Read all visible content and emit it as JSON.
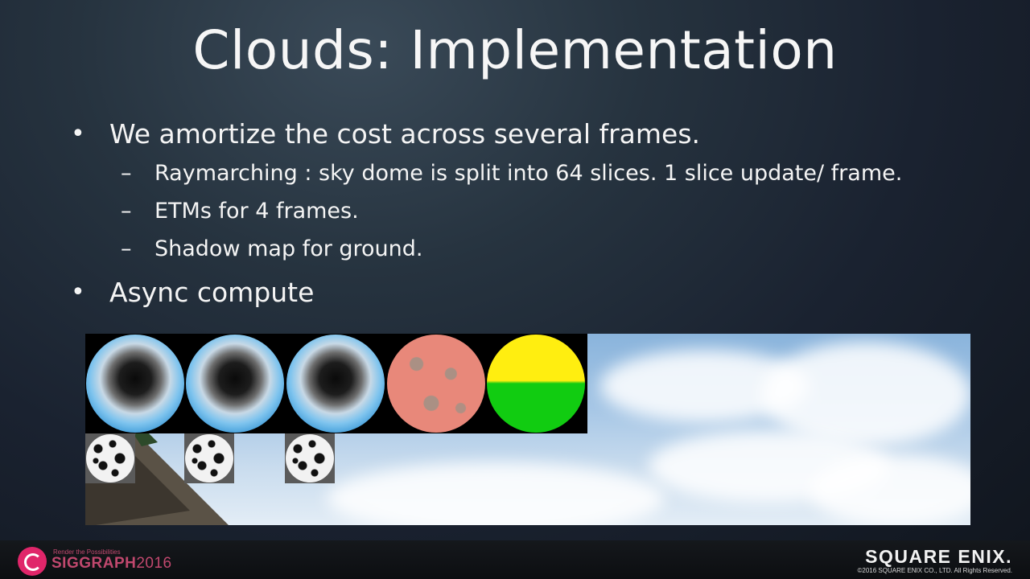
{
  "slide": {
    "title": "Clouds: Implementation",
    "bullets": [
      {
        "text": "We amortize the cost across several frames.",
        "subs": [
          "Raymarching : sky dome is split into 64 slices. 1 slice update/ frame.",
          "ETMs for 4 frames.",
          "Shadow map for ground."
        ]
      },
      {
        "text": "Async compute"
      }
    ],
    "bullet_glyph": "•",
    "dash_glyph": "–"
  },
  "footer": {
    "siggraph_tagline": "Render the Possibilities",
    "siggraph_name": "SIGGRAPH",
    "siggraph_year": "2016",
    "publisher_logo": "SQUARE ENIX.",
    "copyright": "©2016 SQUARE ENIX CO., LTD. All Rights Reserved."
  }
}
